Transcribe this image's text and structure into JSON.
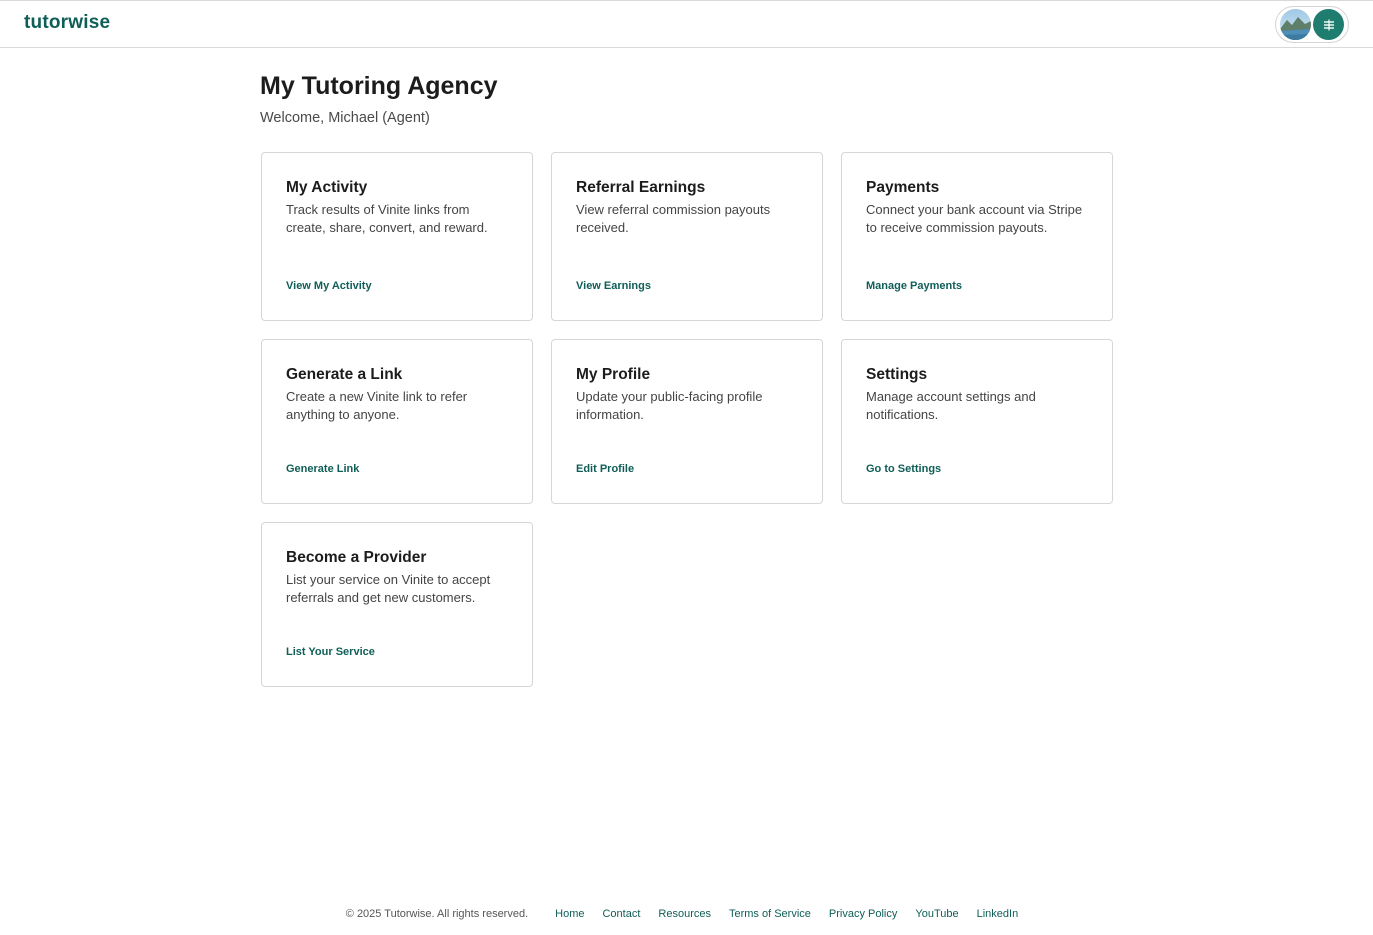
{
  "header": {
    "logo": "tutorwise",
    "avatar_icon": "user-avatar-landscape",
    "menu_icon": "menu-icon"
  },
  "page": {
    "title": "My Tutoring Agency",
    "welcome": "Welcome, Michael (Agent)"
  },
  "cards": [
    {
      "title": "My Activity",
      "description": "Track results of Vinite links from create, share, convert, and reward.",
      "link": "View My Activity"
    },
    {
      "title": "Referral Earnings",
      "description": "View referral commission payouts received.",
      "link": "View Earnings"
    },
    {
      "title": "Payments",
      "description": "Connect your bank account via Stripe to receive commission payouts.",
      "link": "Manage Payments"
    },
    {
      "title": "Generate a Link",
      "description": "Create a new Vinite link to refer anything to anyone.",
      "link": "Generate Link"
    },
    {
      "title": "My Profile",
      "description": "Update your public-facing profile information.",
      "link": "Edit Profile"
    },
    {
      "title": "Settings",
      "description": "Manage account settings and notifications.",
      "link": "Go to Settings"
    },
    {
      "title": "Become a Provider",
      "description": "List your service on Vinite to accept referrals and get new customers.",
      "link": "List Your Service"
    }
  ],
  "footer": {
    "copyright": "© 2025 Tutorwise. All rights reserved.",
    "links": [
      "Home",
      "Contact",
      "Resources",
      "Terms of Service",
      "Privacy Policy",
      "YouTube",
      "LinkedIn"
    ]
  },
  "colors": {
    "brand": "#0f5e57",
    "menu_button": "#1f7d6f",
    "border": "#d6d6d6"
  }
}
